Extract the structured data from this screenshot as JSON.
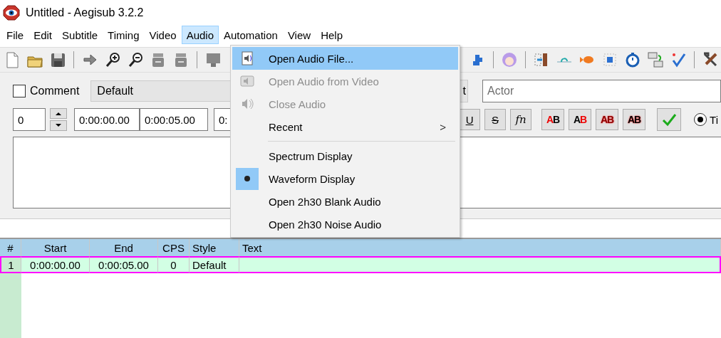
{
  "window": {
    "title": "Untitled - Aegisub 3.2.2"
  },
  "menubar": [
    {
      "label": "File",
      "selected": false
    },
    {
      "label": "Edit",
      "selected": false
    },
    {
      "label": "Subtitle",
      "selected": false
    },
    {
      "label": "Timing",
      "selected": false
    },
    {
      "label": "Video",
      "selected": false
    },
    {
      "label": "Audio",
      "selected": true
    },
    {
      "label": "Automation",
      "selected": false
    },
    {
      "label": "View",
      "selected": false
    },
    {
      "label": "Help",
      "selected": false
    }
  ],
  "edit_box": {
    "comment": {
      "label": "Comment",
      "checked": false
    },
    "style": "Default",
    "button_partial": "t",
    "actor": {
      "placeholder": "Actor"
    },
    "layer": "0",
    "start": "0:00:00.00",
    "end": "0:00:05.00",
    "duration_partial": "0:",
    "format_buttons": [
      {
        "kind": "underline",
        "label": "U"
      },
      {
        "kind": "strike",
        "label": "S"
      },
      {
        "kind": "font",
        "label": "fn"
      },
      {
        "kind": "color1",
        "label": "AB"
      },
      {
        "kind": "color2",
        "label": "AB"
      },
      {
        "kind": "color3",
        "label": "AB"
      },
      {
        "kind": "color4",
        "label": "AB"
      }
    ],
    "radio": {
      "label": "Ti",
      "selected": true
    }
  },
  "grid": {
    "columns": [
      "#",
      "Start",
      "End",
      "CPS",
      "Style",
      "Text"
    ],
    "rows": [
      {
        "cells": [
          "1",
          "0:00:00.00",
          "0:00:05.00",
          "0",
          "Default",
          ""
        ],
        "selected": true
      }
    ]
  },
  "audio_menu": [
    {
      "kind": "item",
      "label": "Open Audio File...",
      "disabled": false,
      "highlighted": true
    },
    {
      "kind": "item",
      "label": "Open Audio from Video",
      "disabled": true,
      "highlighted": false
    },
    {
      "kind": "item",
      "label": "Close Audio",
      "disabled": true,
      "highlighted": false
    },
    {
      "kind": "submenu",
      "label": "Recent",
      "arrow": ">",
      "disabled": false,
      "highlighted": false
    },
    {
      "kind": "separator"
    },
    {
      "kind": "radio",
      "label": "Spectrum Display",
      "selected": false,
      "disabled": false,
      "highlighted": false
    },
    {
      "kind": "radio",
      "label": "Waveform Display",
      "selected": true,
      "disabled": false,
      "highlighted": false
    },
    {
      "kind": "item",
      "label": "Open 2h30 Blank Audio",
      "disabled": false,
      "highlighted": false
    },
    {
      "kind": "item",
      "label": "Open 2h30 Noise Audio",
      "disabled": false,
      "highlighted": false
    }
  ]
}
